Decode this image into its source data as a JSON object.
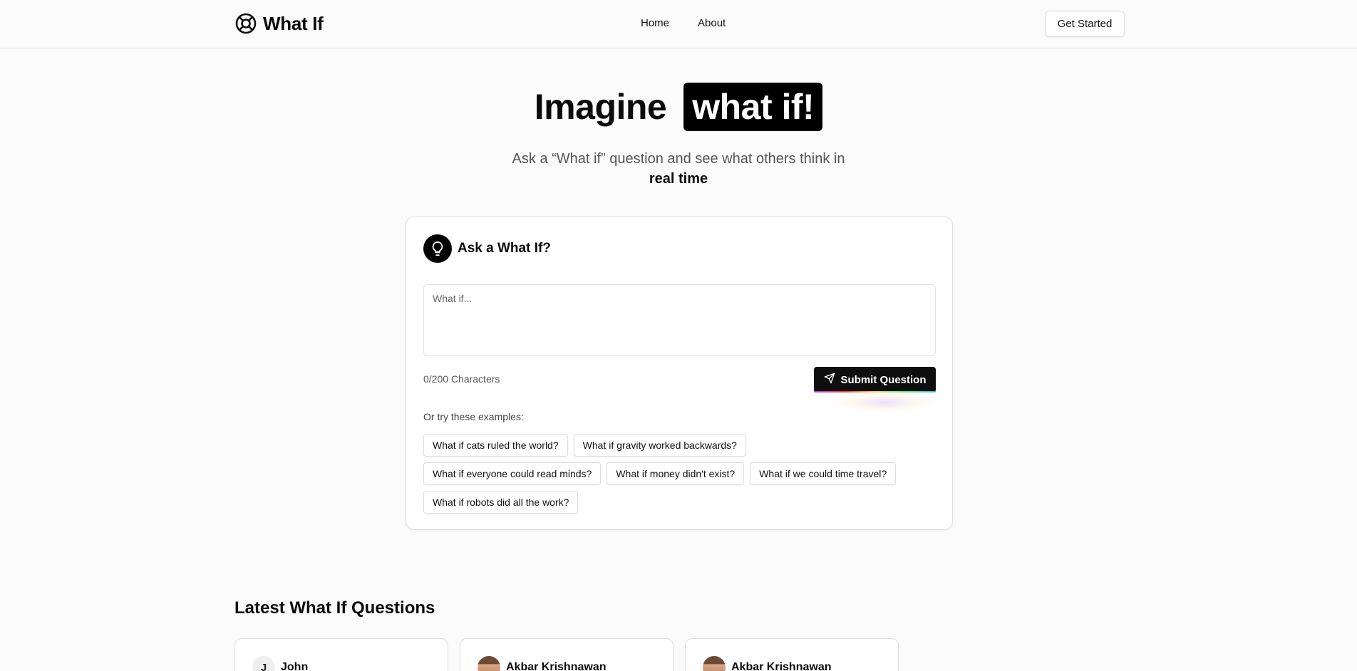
{
  "header": {
    "logo_text": "What If",
    "nav": [
      "Home",
      "About"
    ],
    "cta": "Get Started"
  },
  "hero": {
    "title_plain": "Imagine",
    "title_highlight": "what if!",
    "subtitle": "Ask a “What if” question and see what others think in",
    "subtitle_bold": "real time"
  },
  "ask_card": {
    "title": "Ask a What If?",
    "input_placeholder": "What if...",
    "input_value": "",
    "char_count": "0/200 Characters",
    "submit_label": "Submit Question",
    "examples_label": "Or try these examples:",
    "examples": [
      "What if cats ruled the world?",
      "What if gravity worked backwards?",
      "What if everyone could read minds?",
      "What if money didn't exist?",
      "What if we could time travel?",
      "What if robots did all the work?"
    ]
  },
  "latest": {
    "title": "Latest What If Questions",
    "questions": [
      {
        "user": "John",
        "avatar_initial": "J"
      },
      {
        "user": "Akbar Krishnawan"
      },
      {
        "user": "Akbar Krishnawan"
      }
    ]
  },
  "colors": {
    "background": "#fbfbfb",
    "primary": "#0e0e0e",
    "text_muted": "#555555"
  }
}
